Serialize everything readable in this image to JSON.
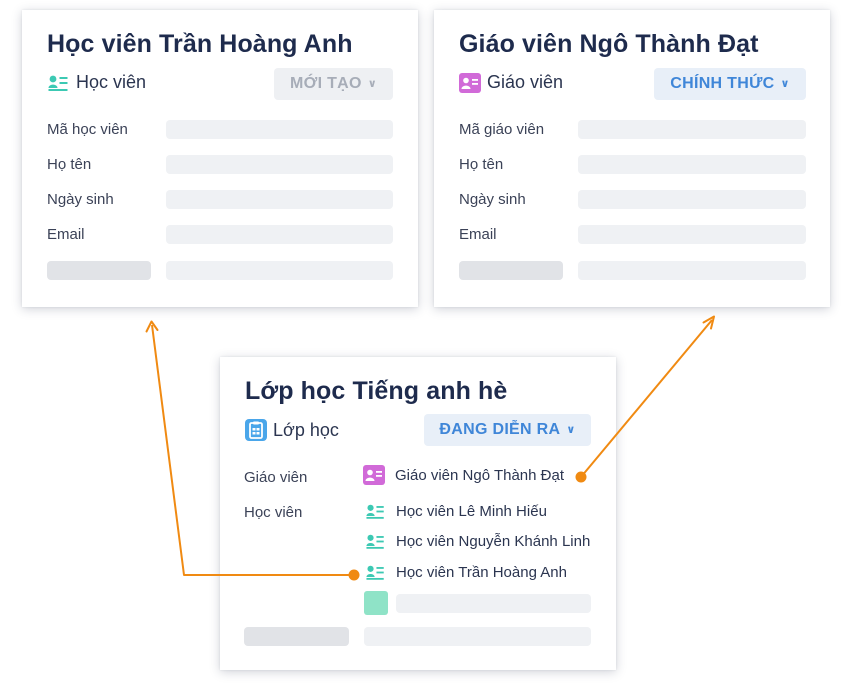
{
  "student_card": {
    "title": "Học viên Trần Hoàng Anh",
    "type_label": "Học viên",
    "status": "MỚI TẠO",
    "fields": [
      "Mã học viên",
      "Họ tên",
      "Ngày sinh",
      "Email"
    ]
  },
  "teacher_card": {
    "title": "Giáo viên Ngô Thành Đạt",
    "type_label": "Giáo viên",
    "status": "CHÍNH THỨC",
    "fields": [
      "Mã giáo viên",
      "Họ tên",
      "Ngày sinh",
      "Email"
    ]
  },
  "class_card": {
    "title": "Lớp học Tiếng anh hè",
    "type_label": "Lớp học",
    "status": "ĐANG DIỄN RA",
    "teacher_label": "Giáo viên",
    "students_label": "Học viên",
    "teacher": "Giáo viên Ngô Thành Đạt",
    "students": [
      "Học viên Lê Minh Hiếu",
      "Học viên Nguyễn Khánh Linh",
      "Học viên Trần Hoàng Anh"
    ]
  },
  "colors": {
    "connector": "#f08a12",
    "student_icon": "#3cc9b3",
    "teacher_icon": "#d16ad8",
    "class_icon": "#4aa6ea",
    "placeholder_swatch": "#8fe3c7"
  },
  "chevron": "∨"
}
